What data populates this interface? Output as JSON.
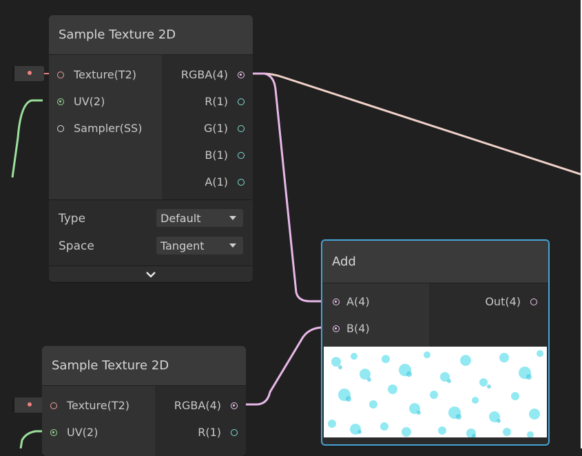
{
  "colors": {
    "background": "#202020",
    "node_body": "#2b2b2b",
    "node_title": "#3a3a3a",
    "selection_outline": "#47a4d6",
    "wire_vector4": "#e8b8e8",
    "wire_vector2": "#9be09b",
    "wire_out": "#f0d2c8"
  },
  "node_top": {
    "title": "Sample Texture 2D",
    "inputs": [
      {
        "label": "Texture(T2)",
        "type": "texture"
      },
      {
        "label": "UV(2)",
        "type": "vector2"
      },
      {
        "label": "Sampler(SS)",
        "type": "sampler"
      }
    ],
    "outputs": [
      {
        "label": "RGBA(4)",
        "type": "vector4"
      },
      {
        "label": "R(1)",
        "type": "vector1"
      },
      {
        "label": "G(1)",
        "type": "vector1"
      },
      {
        "label": "B(1)",
        "type": "vector1"
      },
      {
        "label": "A(1)",
        "type": "vector1"
      }
    ],
    "settings": {
      "type_label": "Type",
      "type_value": "Default",
      "space_label": "Space",
      "space_value": "Tangent"
    },
    "expander_icon": "chevron-down-icon"
  },
  "node_add": {
    "title": "Add",
    "inputs": [
      {
        "label": "A(4)",
        "type": "vector4"
      },
      {
        "label": "B(4)",
        "type": "vector4"
      }
    ],
    "outputs": [
      {
        "label": "Out(4)",
        "type": "vector4"
      }
    ],
    "preview_description": "cyan caustic texture preview"
  },
  "node_bottom": {
    "title": "Sample Texture 2D",
    "inputs": [
      {
        "label": "Texture(T2)",
        "type": "texture"
      },
      {
        "label": "UV(2)",
        "type": "vector2"
      }
    ],
    "outputs": [
      {
        "label": "RGBA(4)",
        "type": "vector4"
      },
      {
        "label": "R(1)",
        "type": "vector1"
      }
    ]
  }
}
